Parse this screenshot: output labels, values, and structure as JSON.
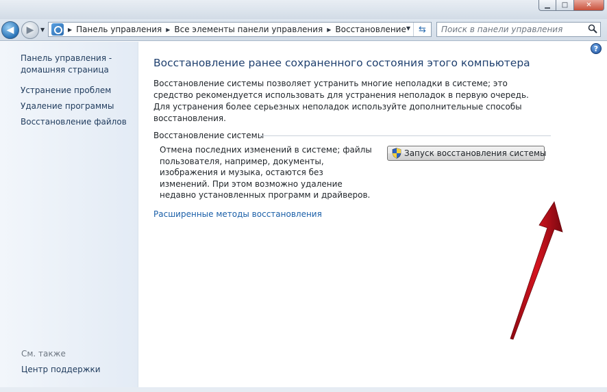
{
  "window": {
    "minimize_glyph": "▁",
    "maximize_glyph": "□",
    "close_glyph": "✕"
  },
  "navigation": {
    "back_glyph": "◀",
    "forward_glyph": "▶",
    "recent_glyph": "▼",
    "address": {
      "icon": "control-panel-icon",
      "breadcrumbs": [
        "Панель управления",
        "Все элементы панели управления",
        "Восстановление"
      ],
      "separator_glyph": "▶",
      "dropdown_glyph": "▼",
      "refresh_glyph": "⇆"
    },
    "search": {
      "placeholder": "Поиск в панели управления",
      "icon": "search-icon"
    }
  },
  "sidebar": {
    "home_link": "Панель управления - домашняя страница",
    "items": [
      "Устранение проблем",
      "Удаление программы",
      "Восстановление файлов"
    ],
    "see_also_label": "См. также",
    "see_also_items": [
      "Центр поддержки"
    ]
  },
  "main": {
    "help_glyph": "?",
    "title": "Восстановление ранее сохраненного состояния этого компьютера",
    "intro": "Восстановление системы позволяет устранить многие неполадки в системе; это средство рекомендуется использовать для устранения неполадок в первую очередь. Для устранения более серьезных неполадок используйте дополнительные способы восстановления.",
    "system_restore": {
      "heading": "Восстановление системы",
      "description": "Отмена последних изменений в системе; файлы пользователя, например, документы, изображения и музыка, остаются без изменений. При этом возможно удаление недавно установленных программ и драйверов.",
      "button_label": "Запуск восстановления системы",
      "button_icon": "uac-shield-icon"
    },
    "advanced_link": "Расширенные методы восстановления"
  },
  "annotation": {
    "arrow_color": "#c0101a",
    "arrow_icon": "red-arrow-annotation"
  }
}
